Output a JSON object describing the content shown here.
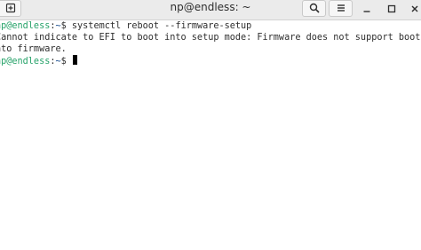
{
  "window": {
    "title": "np@endless: ~"
  },
  "headerbar": {
    "new_tab_icon": "new-tab-icon",
    "search_icon": "search-icon",
    "menu_icon": "hamburger-menu-icon",
    "minimize_icon": "minimize-icon",
    "maximize_icon": "maximize-icon",
    "close_icon": "close-icon"
  },
  "terminal": {
    "lines": [
      {
        "prompt_user": "np@endless",
        "prompt_sep": ":",
        "prompt_path": "~",
        "prompt_symbol": "$ ",
        "command": "systemctl reboot --firmware-setup"
      },
      {
        "output": "Cannot indicate to EFI to boot into setup mode: Firmware does not support boot i"
      },
      {
        "output": "nto firmware."
      },
      {
        "prompt_user": "np@endless",
        "prompt_sep": ":",
        "prompt_path": "~",
        "prompt_symbol": "$ ",
        "command": ""
      }
    ]
  },
  "colors": {
    "prompt_user": "#26a269",
    "prompt_path": "#12488b",
    "text": "#2e2e2e",
    "background": "#ffffff",
    "headerbar": "#ebebeb"
  }
}
